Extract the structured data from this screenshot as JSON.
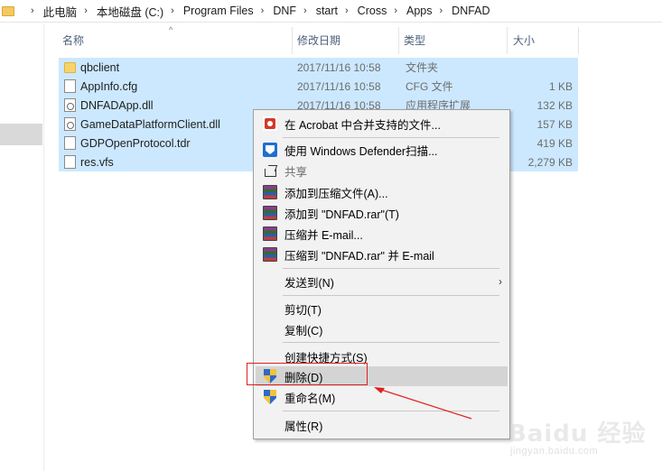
{
  "breadcrumb": [
    "此电脑",
    "本地磁盘 (C:)",
    "Program Files",
    "DNF",
    "start",
    "Cross",
    "Apps",
    "DNFAD"
  ],
  "columns": {
    "name": "名称",
    "date": "修改日期",
    "type": "类型",
    "size": "大小"
  },
  "files": [
    {
      "name": "qbclient",
      "date": "2017/11/16 10:58",
      "type": "文件夹",
      "size": "",
      "icon": "folder-icon"
    },
    {
      "name": "AppInfo.cfg",
      "date": "2017/11/16 10:58",
      "type": "CFG 文件",
      "size": "1 KB",
      "icon": "file-icon"
    },
    {
      "name": "DNFADApp.dll",
      "date": "2017/11/16 10:58",
      "type": "应用程序扩展",
      "size": "132 KB",
      "icon": "dll-icon"
    },
    {
      "name": "GameDataPlatformClient.dll",
      "date": "",
      "type": "",
      "size": "157 KB",
      "icon": "dll-icon"
    },
    {
      "name": "GDPOpenProtocol.tdr",
      "date": "",
      "type": "",
      "size": "419 KB",
      "icon": "file-icon"
    },
    {
      "name": "res.vfs",
      "date": "",
      "type": "",
      "size": "2,279 KB",
      "icon": "file-icon"
    }
  ],
  "context_menu": {
    "acrobat": "在 Acrobat 中合并支持的文件...",
    "defender": "使用 Windows Defender扫描...",
    "share": "共享",
    "add_archive": "添加到压缩文件(A)...",
    "add_rar": "添加到 \"DNFAD.rar\"(T)",
    "compress_email": "压缩并 E-mail...",
    "compress_rar_email": "压缩到 \"DNFAD.rar\" 并 E-mail",
    "send_to": "发送到(N)",
    "cut": "剪切(T)",
    "copy": "复制(C)",
    "create_shortcut": "创建快捷方式(S)",
    "delete": "删除(D)",
    "rename": "重命名(M)",
    "properties": "属性(R)"
  },
  "watermark": {
    "logo": "Baidu 经验",
    "sub": "jingyan.baidu.com"
  },
  "colors": {
    "selection": "#cce8ff",
    "menu_bg": "#f2f2f2",
    "menu_hover": "#d4d4d4",
    "annotation": "#e02020"
  }
}
